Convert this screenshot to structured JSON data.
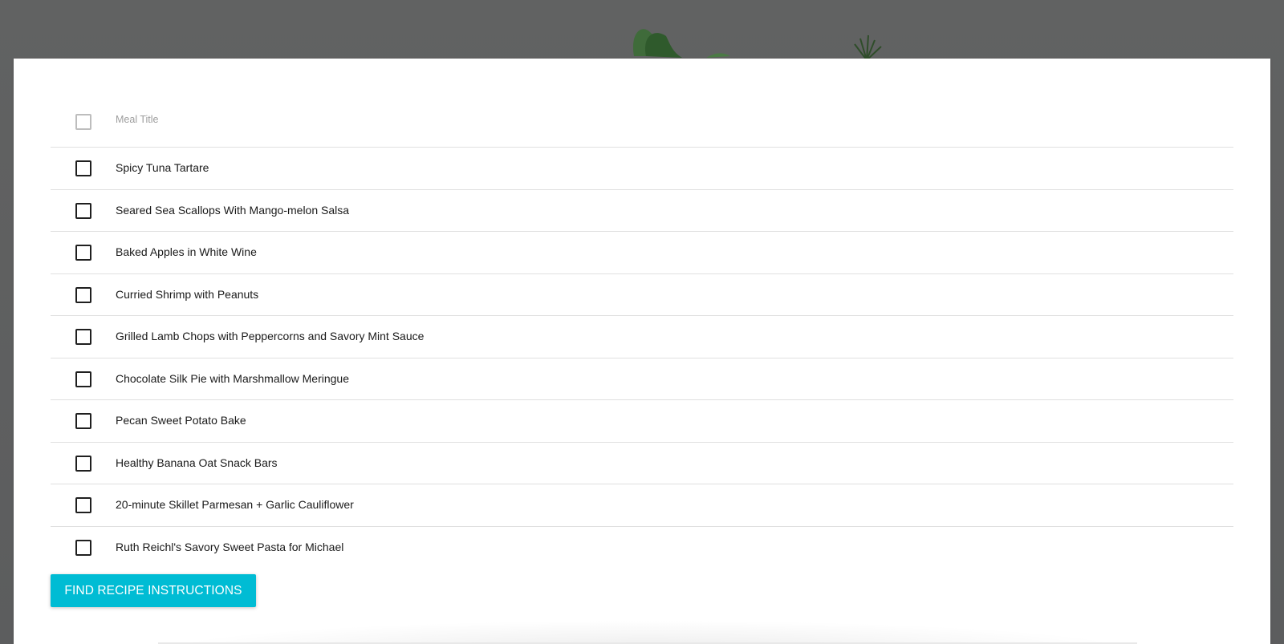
{
  "table": {
    "header_label": "Meal Title",
    "rows": [
      "Spicy Tuna Tartare",
      "Seared Sea Scallops With Mango-melon Salsa",
      "Baked Apples in White Wine",
      "Curried Shrimp with Peanuts",
      "Grilled Lamb Chops with Peppercorns and Savory Mint Sauce",
      "Chocolate Silk Pie with Marshmallow Meringue",
      "Pecan Sweet Potato Bake",
      "Healthy Banana Oat Snack Bars",
      "20-minute Skillet Parmesan + Garlic Cauliflower",
      "Ruth Reichl's Savory Sweet Pasta for Michael"
    ]
  },
  "action": {
    "label": "FIND RECIPE INSTRUCTIONS"
  },
  "colors": {
    "accent": "#00bcd4",
    "backdrop": "#5f6061"
  },
  "icons": {
    "checkbox": "checkbox-unchecked-icon"
  }
}
